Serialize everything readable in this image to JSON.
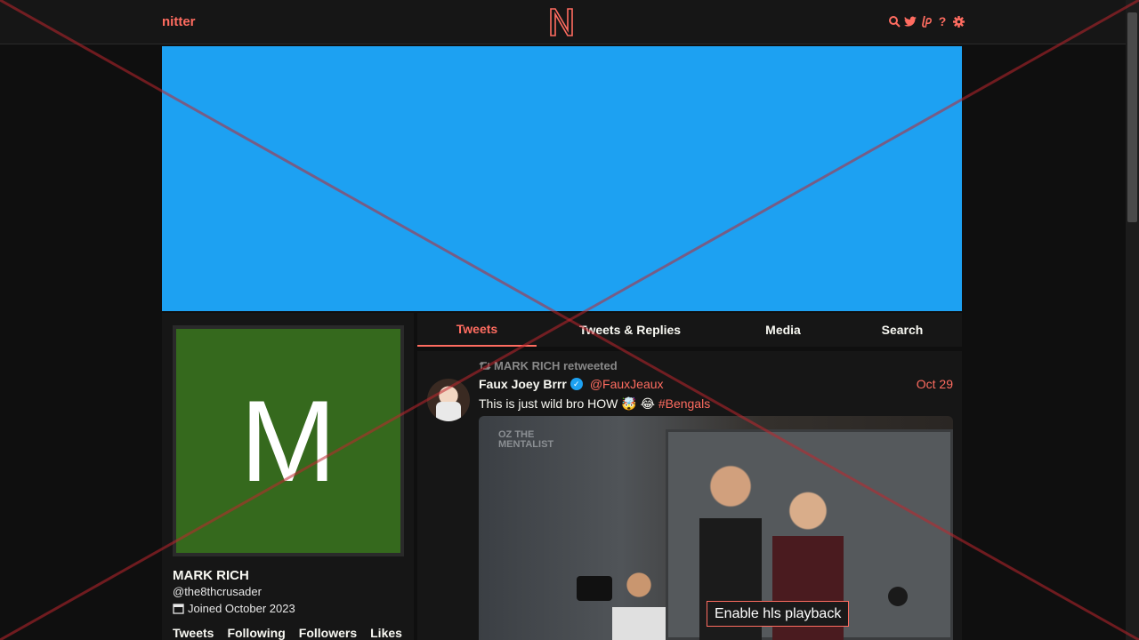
{
  "nav": {
    "brand": "nitter",
    "icons": [
      "search-icon",
      "twitter-bird-icon",
      "liberapay-icon",
      "help-icon",
      "gear-icon"
    ]
  },
  "banner": {
    "color": "#1da1f2"
  },
  "profile": {
    "avatar_letter": "M",
    "avatar_color": "#35691d",
    "name": "MARK RICH",
    "handle": "@the8thcrusader",
    "joined": "Joined October 2023",
    "stats": [
      "Tweets",
      "Following",
      "Followers",
      "Likes"
    ]
  },
  "tabs": [
    "Tweets",
    "Tweets & Replies",
    "Media",
    "Search"
  ],
  "active_tab": "Tweets",
  "tweet": {
    "retweet_label": "MARK RICH retweeted",
    "fullname": "Faux Joey Brrr",
    "username": "@FauxJeaux",
    "date": "Oct 29",
    "text": "This is just wild bro HOW 🤯 😂",
    "hashtag": "#Bengals",
    "media_caption_line1": "OZ THE",
    "media_caption_line2": "MENTALIST",
    "hls_button": "Enable hls playback"
  },
  "colors": {
    "accent": "#ff6c60",
    "background": "#0f0f0f",
    "panel": "#161616"
  }
}
